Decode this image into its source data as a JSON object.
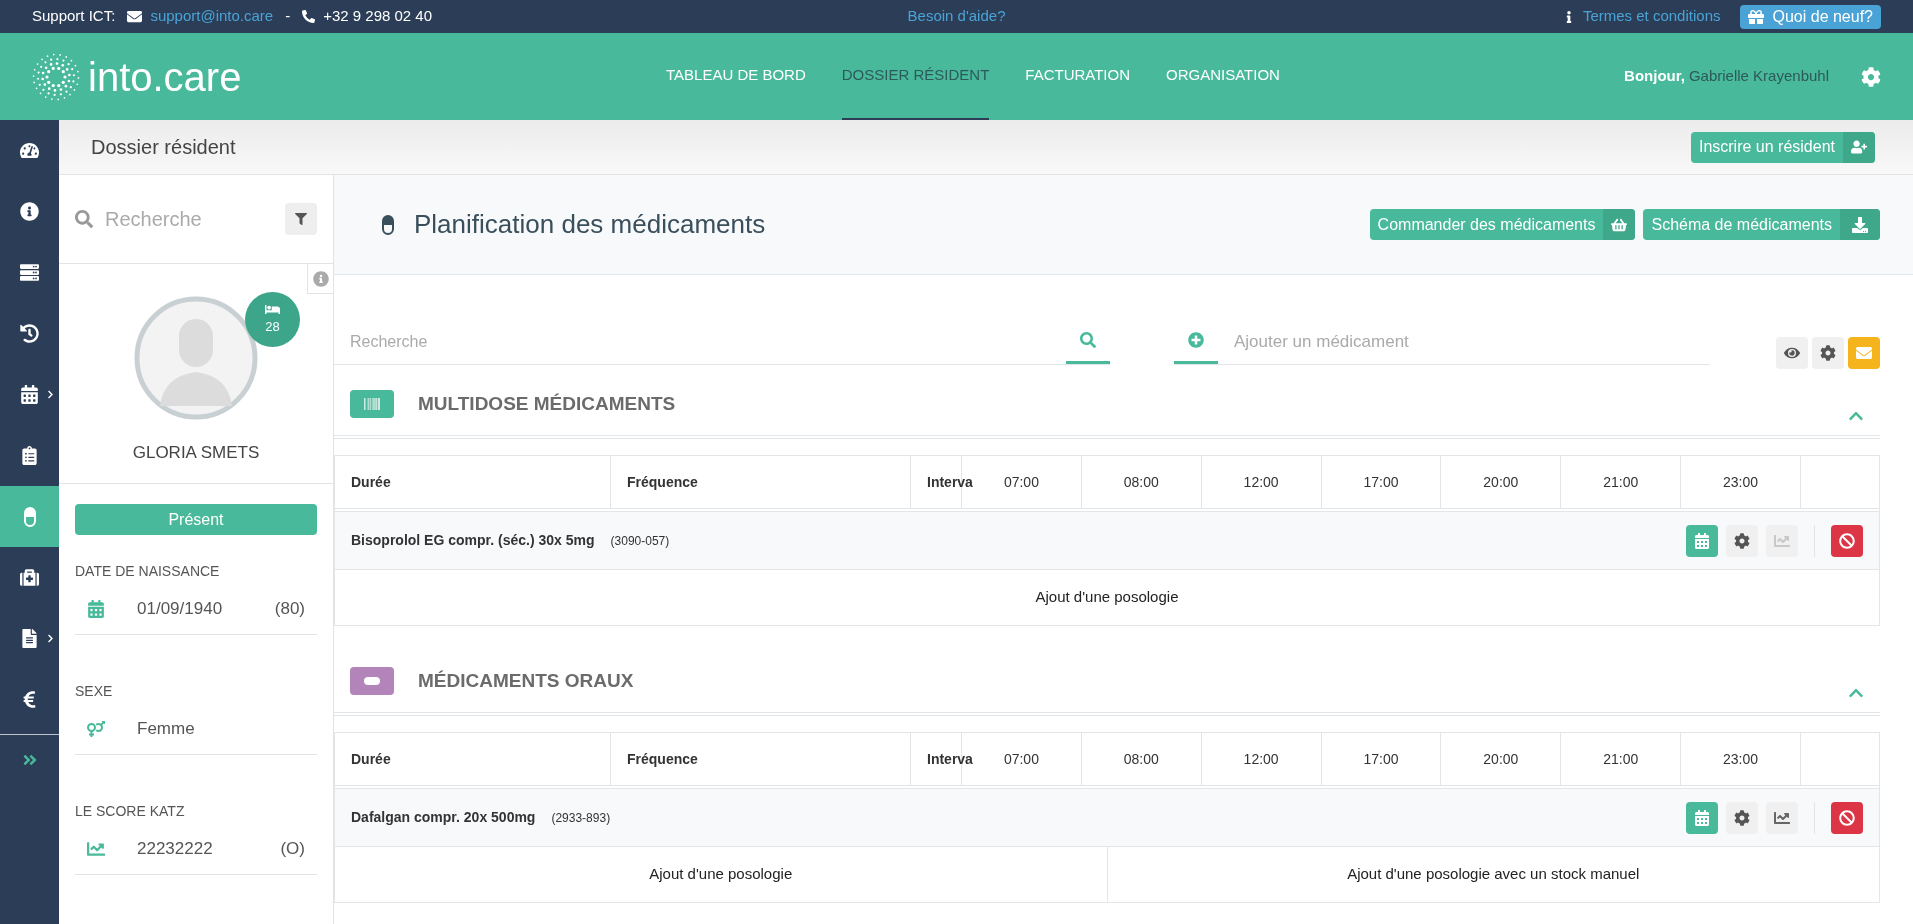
{
  "topbar": {
    "support_label": "Support ICT:",
    "email": "support@into.care",
    "separator": "-",
    "phone": "+32 9 298 02 40",
    "help_link": "Besoin d'aide?",
    "terms_link": "Termes et conditions",
    "news_button": "Quoi de neuf?"
  },
  "header": {
    "logo": "into.care",
    "nav": [
      {
        "label": "TABLEAU DE BORD",
        "selected": false
      },
      {
        "label": "DOSSIER RÉSIDENT",
        "selected": true
      },
      {
        "label": "FACTURATION",
        "selected": false
      },
      {
        "label": "ORGANISATION",
        "selected": false
      }
    ],
    "greeting": "Bonjour,",
    "user_name": "Gabrielle Krayenbuhl"
  },
  "sidebar": {
    "items": [
      {
        "selected": false,
        "submenu": false
      },
      {
        "selected": false,
        "submenu": false
      },
      {
        "selected": false,
        "submenu": false
      },
      {
        "selected": false,
        "submenu": false
      },
      {
        "selected": false,
        "submenu": true
      },
      {
        "selected": false,
        "submenu": false
      },
      {
        "selected": true,
        "submenu": false
      },
      {
        "selected": false,
        "submenu": false
      },
      {
        "selected": false,
        "submenu": true
      },
      {
        "selected": false,
        "submenu": false
      }
    ]
  },
  "subheader": {
    "title": "Dossier résident",
    "register_button": "Inscrire un résident"
  },
  "patient": {
    "search_placeholder": "Recherche",
    "room": "28",
    "name": "GLORIA SMETS",
    "status": "Présent",
    "fields": [
      {
        "label": "DATE DE NAISSANCE",
        "value": "01/09/1940",
        "extra": "(80)"
      },
      {
        "label": "SEXE",
        "value": "Femme"
      },
      {
        "label": "LE SCORE KATZ",
        "value": "22232222",
        "extra": "(O)"
      }
    ]
  },
  "main": {
    "title": "Planification des médicaments",
    "order_button": "Commander des médicaments",
    "schema_button": "Schéma de médicaments",
    "search_placeholder": "Recherche",
    "add_placeholder": "Ajouter un médicament",
    "sections": [
      {
        "title": "MULTIDOSE MÉDICAMENTS",
        "kind": "multidose",
        "color": "#48b99a",
        "columns": [
          "Durée",
          "Fréquence",
          "Interva",
          "07:00",
          "08:00",
          "12:00",
          "17:00",
          "20:00",
          "21:00",
          "23:00"
        ],
        "drug": {
          "name": "Bisoprolol EG compr. (séc.) 30x 5mg",
          "code": "(3090-057)",
          "chart_enabled": false
        },
        "actions": [
          "Ajout d'une posologie"
        ]
      },
      {
        "title": "MÉDICAMENTS ORAUX",
        "kind": "oral",
        "color": "#b384b9",
        "columns": [
          "Durée",
          "Fréquence",
          "Interva",
          "07:00",
          "08:00",
          "12:00",
          "17:00",
          "20:00",
          "21:00",
          "23:00"
        ],
        "drug": {
          "name": "Dafalgan compr. 20x 500mg",
          "code": "(2933-893)",
          "chart_enabled": true
        },
        "actions": [
          "Ajout d'une posologie",
          "Ajout d'une posologie avec un stock manuel"
        ]
      }
    ]
  }
}
